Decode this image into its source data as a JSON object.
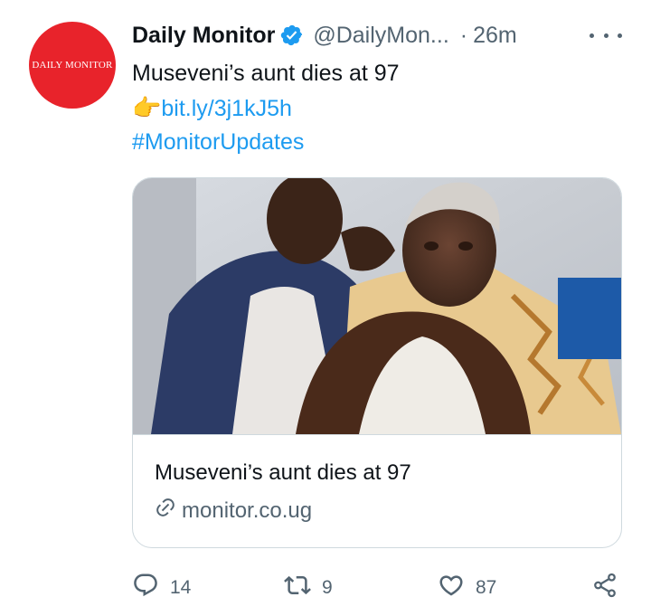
{
  "account": {
    "name": "Daily Monitor",
    "handle": "@DailyMon...",
    "separator": "·",
    "time": "26m",
    "avatar_text": "DAILY MONITOR",
    "avatar_color": "#e8232b"
  },
  "tweet": {
    "text": "Museveni’s aunt dies at 97",
    "pointer_emoji": "👉",
    "link": "bit.ly/3j1kJ5h",
    "hashtag": "#MonitorUpdates"
  },
  "card": {
    "title": "Museveni’s aunt dies at 97",
    "domain": "monitor.co.ug",
    "domain_icon": "link-icon"
  },
  "actions": {
    "reply_count": "14",
    "retweet_count": "9",
    "like_count": "87"
  },
  "colors": {
    "link": "#1d9bf0",
    "secondary_text": "#536471",
    "verified": "#1d9bf0"
  }
}
